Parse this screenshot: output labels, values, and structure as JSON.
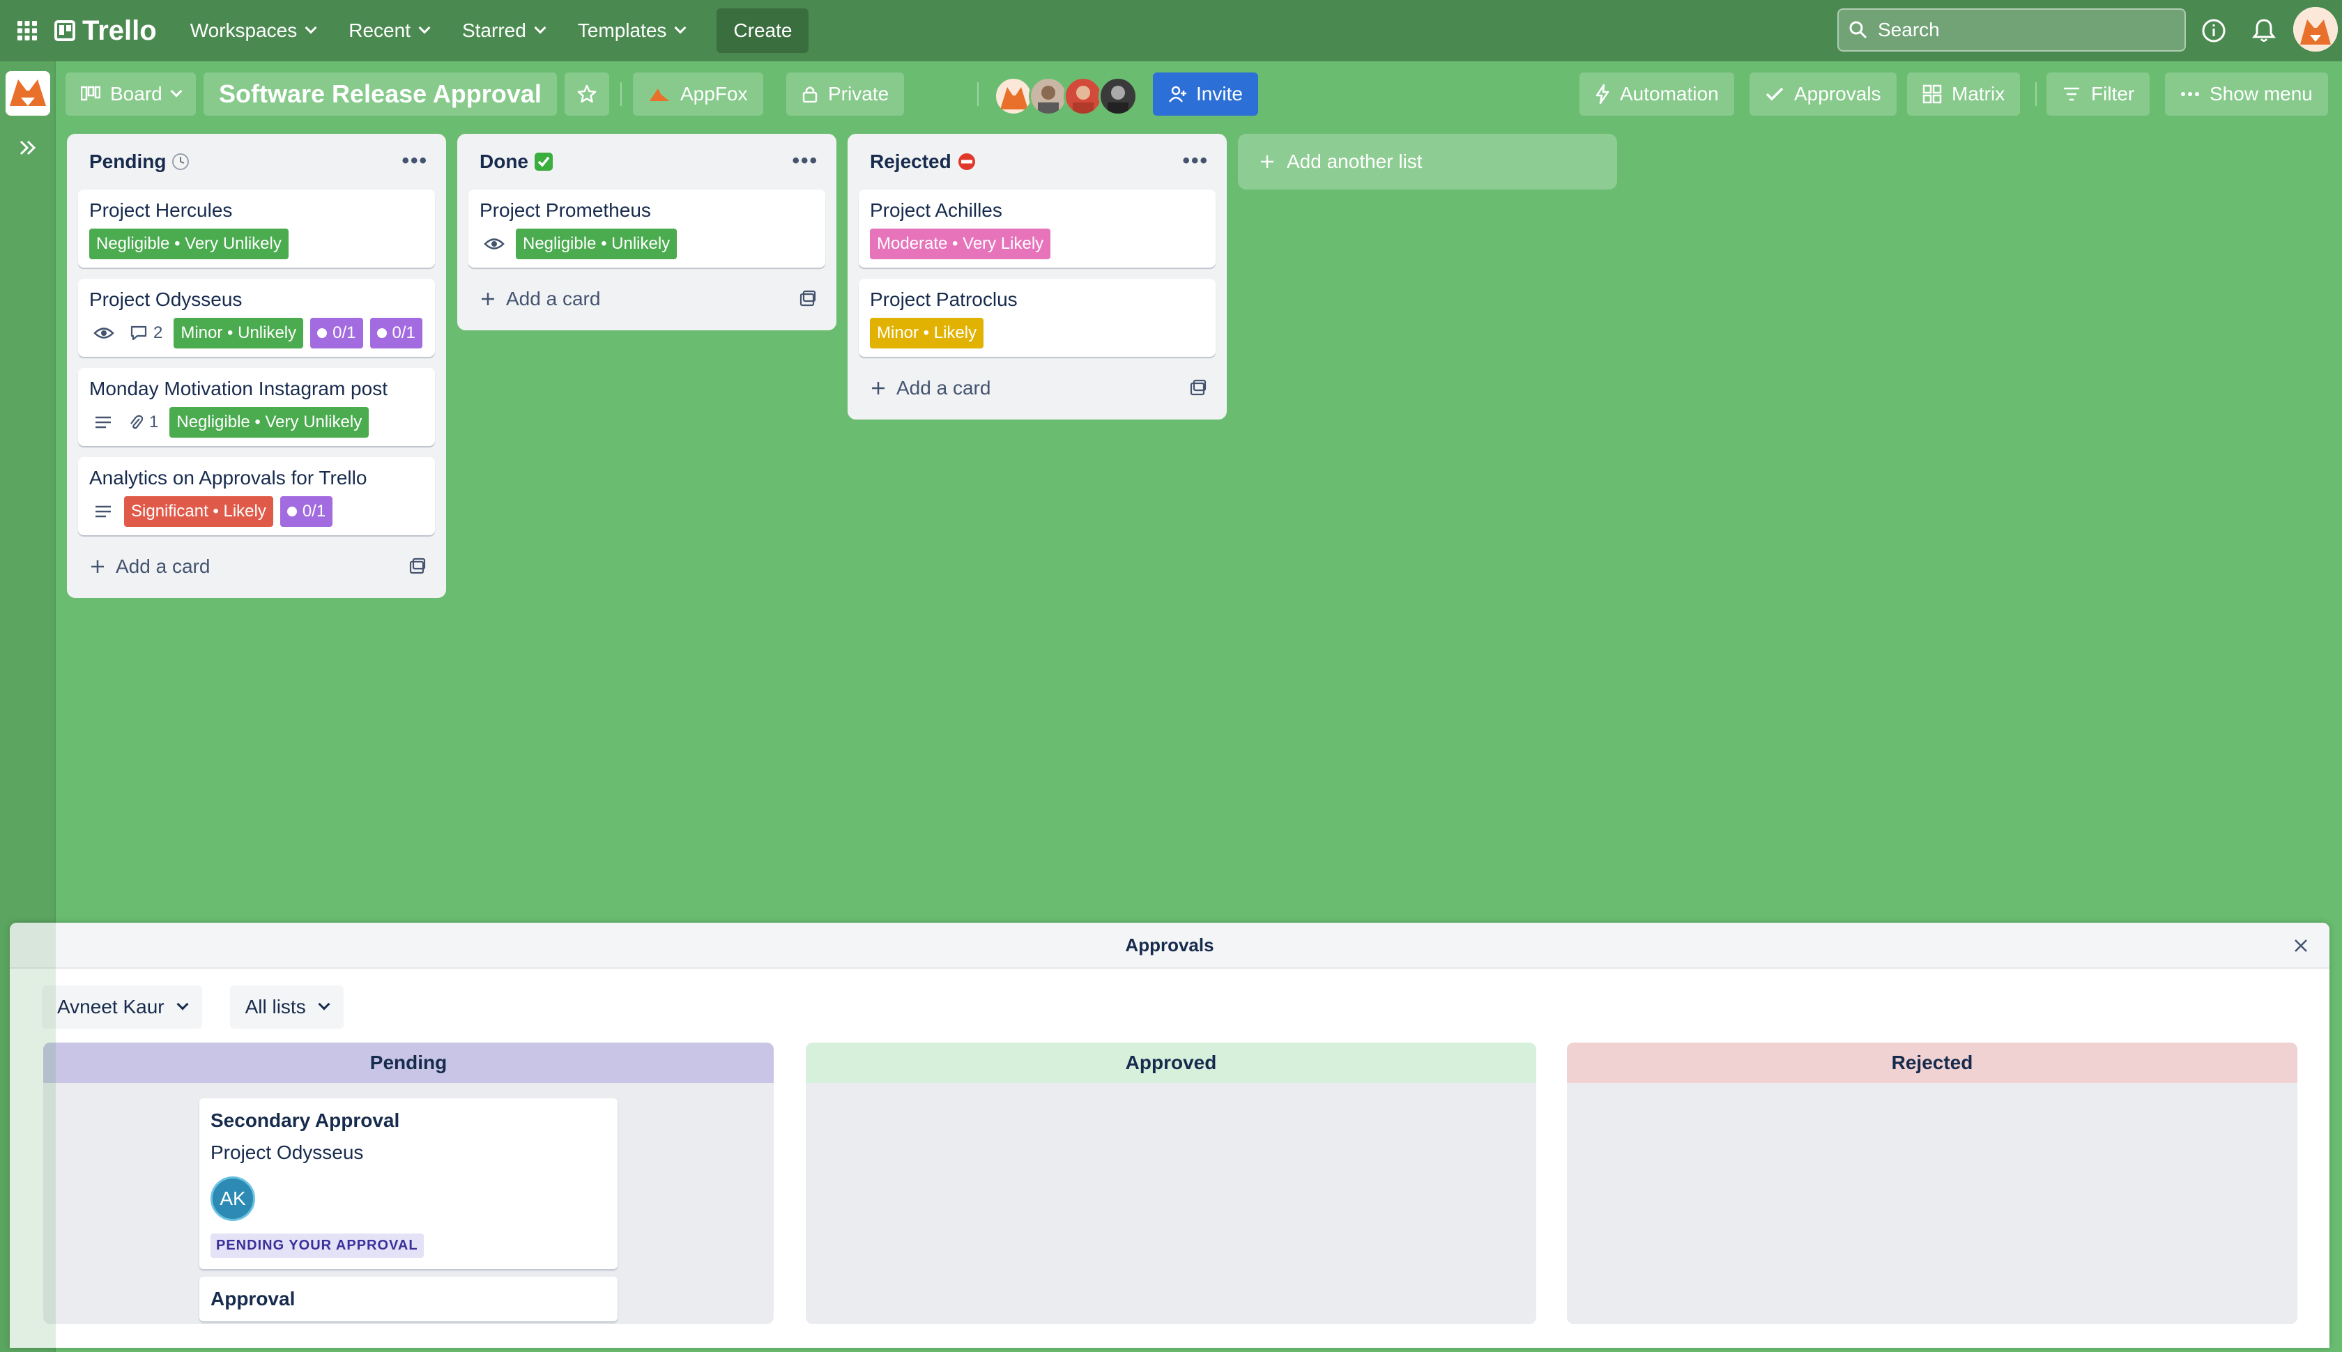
{
  "nav": {
    "brand": "Trello",
    "items": [
      "Workspaces",
      "Recent",
      "Starred",
      "Templates"
    ],
    "create_label": "Create",
    "search_placeholder": "Search"
  },
  "board": {
    "view_label": "Board",
    "title": "Software Release Approval",
    "workspace_label": "AppFox",
    "visibility_label": "Private",
    "invite_label": "Invite",
    "automation_label": "Automation",
    "approvals_label": "Approvals",
    "matrix_label": "Matrix",
    "filter_label": "Filter",
    "show_menu_label": "Show menu"
  },
  "colors": {
    "background": "#6abd70",
    "green_label": "#4bab4f",
    "pink_label": "#e774bb",
    "yellow_label": "#e2b203",
    "red_label": "#e05a4a",
    "purple_label": "#a36be0",
    "invite_blue": "#2c6fd6"
  },
  "lists": [
    {
      "title": "Pending",
      "title_icon": "clock-icon",
      "add_card_label": "Add a card",
      "cards": [
        {
          "title": "Project Hercules",
          "label": "Negligible • Very Unlikely",
          "label_color": "green"
        },
        {
          "title": "Project Odysseus",
          "comments": "2",
          "label": "Minor • Unlikely",
          "label_color": "green",
          "checklist_a": "0/1",
          "checklist_b": "0/1"
        },
        {
          "title": "Monday Motivation Instagram post",
          "attachments": "1",
          "label": "Negligible • Very Unlikely",
          "label_color": "green"
        },
        {
          "title": "Analytics on Approvals for Trello",
          "label": "Significant • Likely",
          "label_color": "red",
          "checklist_a": "0/1"
        }
      ]
    },
    {
      "title": "Done",
      "title_icon": "check-icon",
      "add_card_label": "Add a card",
      "cards": [
        {
          "title": "Project Prometheus",
          "label": "Negligible • Unlikely",
          "label_color": "green"
        }
      ]
    },
    {
      "title": "Rejected",
      "title_icon": "no-entry-icon",
      "add_card_label": "Add a card",
      "cards": [
        {
          "title": "Project Achilles",
          "label": "Moderate • Very Likely",
          "label_color": "pink"
        },
        {
          "title": "Project Patroclus",
          "label": "Minor • Likely",
          "label_color": "yellow"
        }
      ]
    }
  ],
  "add_list_label": "Add another list",
  "approvals_panel": {
    "title": "Approvals",
    "user_filter": "Avneet Kaur",
    "list_filter": "All lists",
    "columns": [
      "Pending",
      "Approved",
      "Rejected"
    ],
    "cards": [
      {
        "title": "Secondary Approval",
        "card": "Project Odysseus",
        "avatar_initials": "AK",
        "status": "PENDING YOUR APPROVAL"
      },
      {
        "title": "Approval"
      }
    ]
  }
}
